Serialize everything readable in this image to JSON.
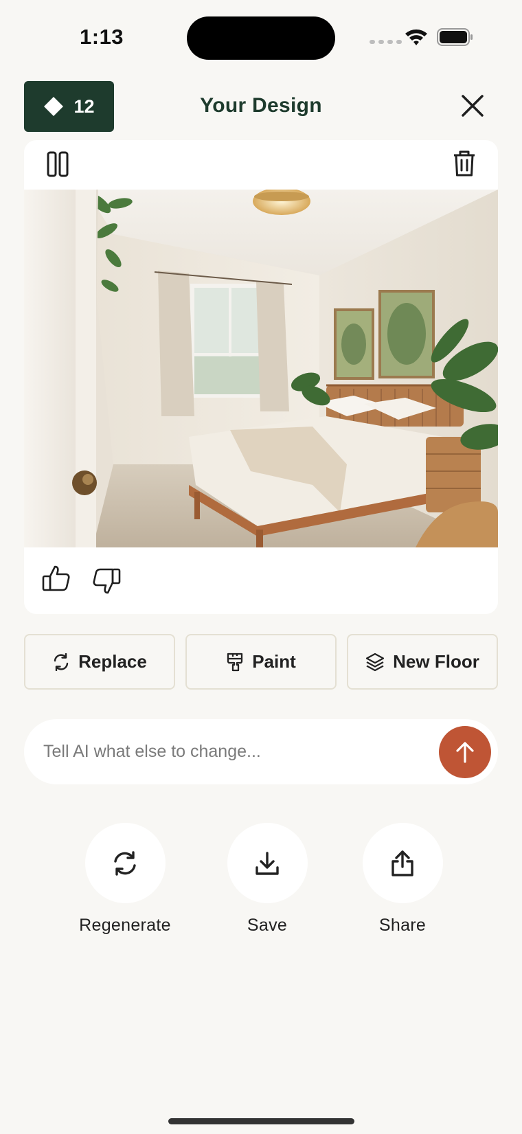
{
  "status_bar": {
    "time": "1:13"
  },
  "header": {
    "credits": "12",
    "title": "Your Design"
  },
  "card": {
    "image_alt": "Bedroom design render"
  },
  "tools": [
    {
      "label": "Replace",
      "icon": "refresh-icon"
    },
    {
      "label": "Paint",
      "icon": "paint-roller-icon"
    },
    {
      "label": "New Floor",
      "icon": "layers-icon"
    }
  ],
  "prompt": {
    "placeholder": "Tell AI what else to change...",
    "value": ""
  },
  "actions": [
    {
      "label": "Regenerate",
      "icon": "regenerate-icon"
    },
    {
      "label": "Save",
      "icon": "download-icon"
    },
    {
      "label": "Share",
      "icon": "share-icon"
    }
  ],
  "colors": {
    "brand_green": "#1e3b2d",
    "accent": "#bf5535",
    "background": "#f8f7f4"
  }
}
